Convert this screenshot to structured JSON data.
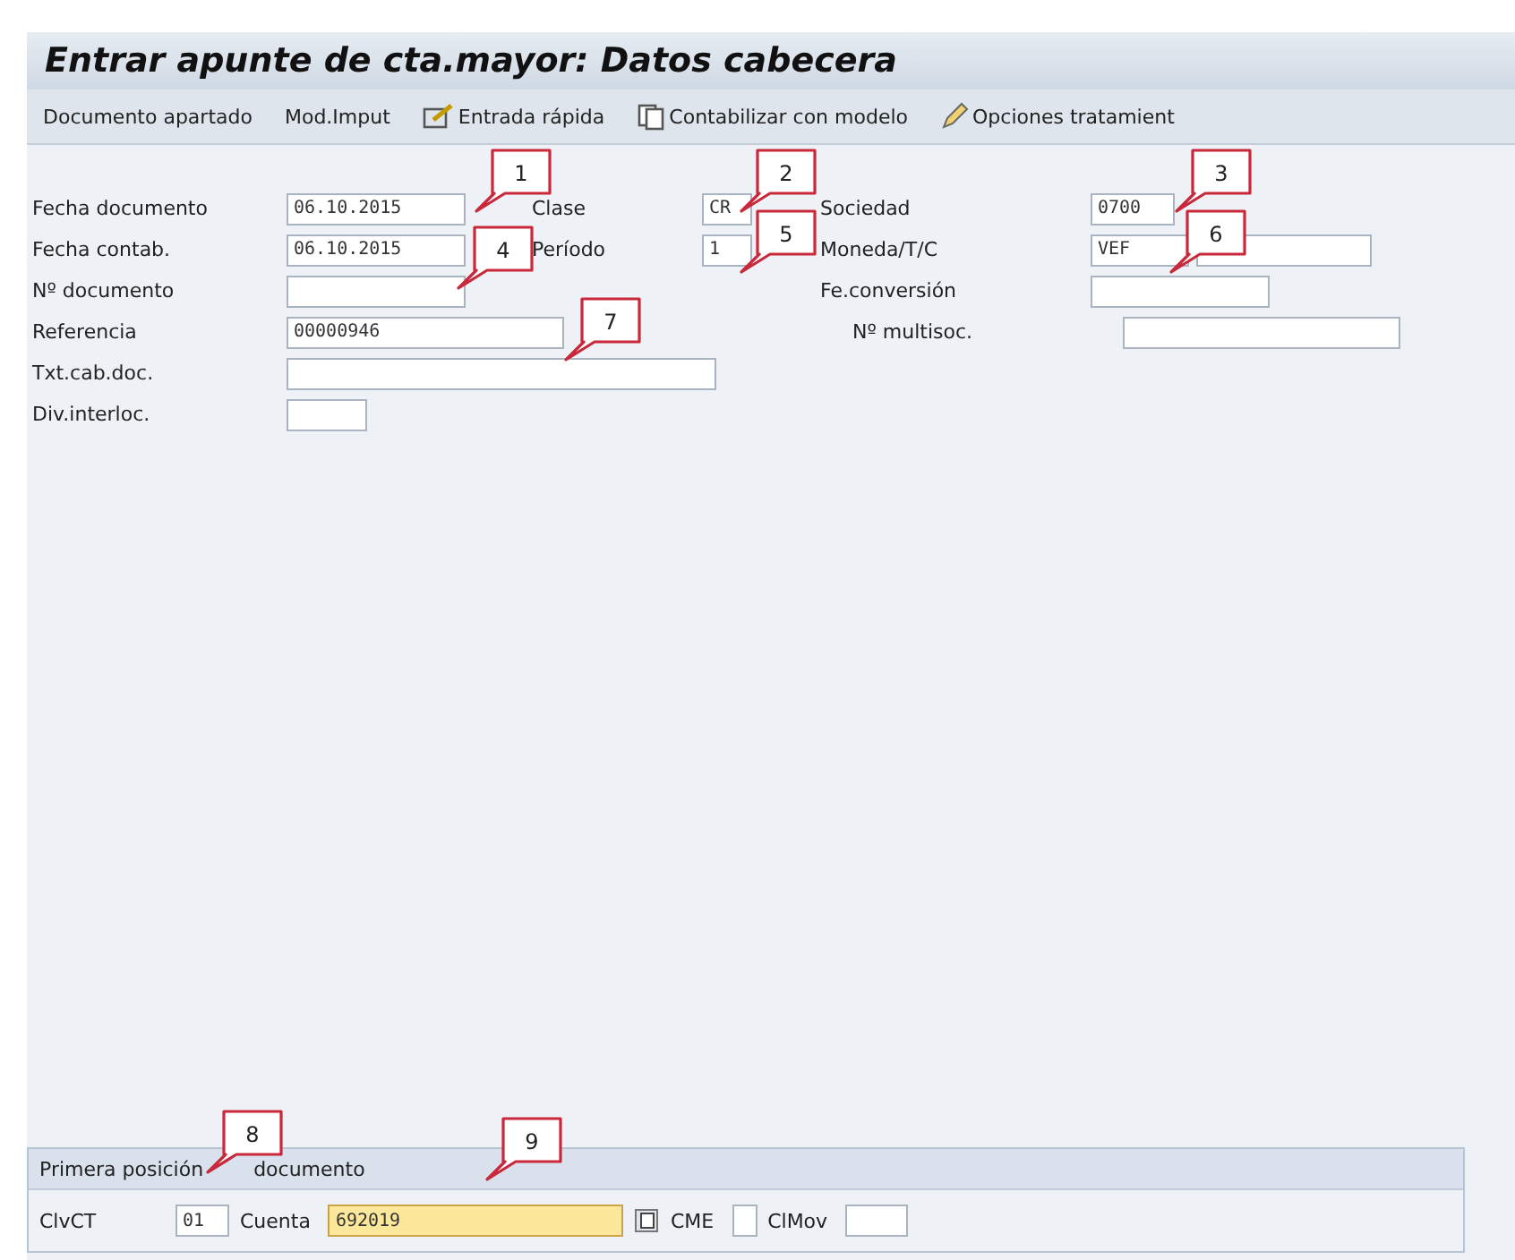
{
  "window": {
    "title": "Entrar apunte de cta.mayor: Datos cabecera"
  },
  "toolbar": [
    {
      "label": "Documento apartado"
    },
    {
      "label": "Mod.Imput"
    },
    {
      "label": "Entrada rápida"
    },
    {
      "label": "Contabilizar con modelo"
    },
    {
      "label": "Opciones tratamient"
    }
  ],
  "header_rows": [
    [
      {
        "label": "Fecha documento",
        "value": "06.10.2015"
      },
      {
        "label": "Clase",
        "value": "CR"
      },
      {
        "label": "Sociedad",
        "value": "0700"
      }
    ],
    [
      {
        "label": "Fecha contab.",
        "value": "06.10.2015"
      },
      {
        "label": "Período",
        "value": "1"
      },
      {
        "label": "Moneda/T/C",
        "value": "VEF"
      }
    ],
    [
      {
        "label": "Nº documento"
      },
      null,
      {
        "label": "Fe.conversión"
      }
    ],
    [
      {
        "label": "Referencia",
        "value": "00000946"
      },
      null,
      {
        "label": "Nº multisoc."
      }
    ],
    [
      {
        "label": "Txt.cab.doc."
      }
    ],
    [
      {
        "label": "Div.interloc."
      }
    ]
  ],
  "first_item": {
    "title_parts": [
      "Primera posición",
      "documento"
    ],
    "entries": [
      {
        "kind": "label",
        "text": "ClvCT"
      },
      {
        "kind": "field",
        "value": "01",
        "focused": false
      },
      {
        "kind": "label",
        "text": "Cuenta"
      },
      {
        "kind": "field",
        "value": "692019",
        "focused": true
      },
      {
        "kind": "label",
        "text": "CME"
      },
      {
        "kind": "field",
        "focused": false
      },
      {
        "kind": "label",
        "text": "ClMov"
      },
      {
        "kind": "field",
        "focused": false
      }
    ]
  },
  "callouts": [
    "1",
    "2",
    "3",
    "4",
    "5",
    "6",
    "7",
    "8",
    "9"
  ]
}
